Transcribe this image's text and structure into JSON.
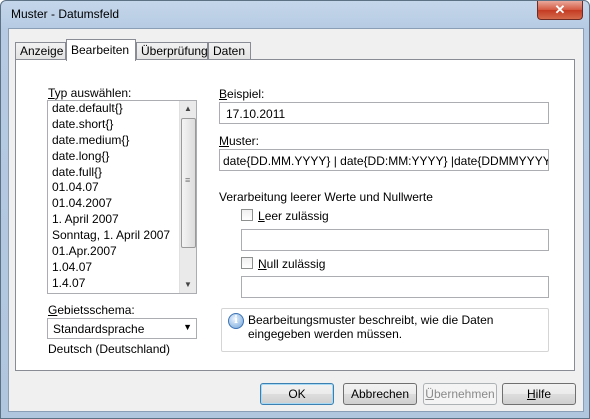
{
  "window": {
    "title": "Muster - Datumsfeld",
    "close_glyph": "✕"
  },
  "tabs": [
    {
      "label": "Anzeige",
      "active": false
    },
    {
      "label": "Bearbeiten",
      "active": true
    },
    {
      "label": "Überprüfung",
      "active": false
    },
    {
      "label": "Daten",
      "active": false
    }
  ],
  "left": {
    "type_label_first": "T",
    "type_label_rest": "yp auswählen:",
    "type_items": [
      "date.default{}",
      "date.short{}",
      "date.medium{}",
      "date.long{}",
      "date.full{}",
      "01.04.07",
      "01.04.2007",
      "1. April 2007",
      "Sonntag, 1. April 2007",
      "01.Apr.2007",
      "1.04.07",
      "1.4.07"
    ],
    "locale_label_first": "G",
    "locale_label_rest": "ebietsschema:",
    "locale_value": "Standardsprache",
    "locale_text": "Deutsch (Deutschland)"
  },
  "right": {
    "example_label_first": "B",
    "example_label_rest": "eispiel:",
    "example_value": "17.10.2011",
    "pattern_label_first": "M",
    "pattern_label_rest": "uster:",
    "pattern_value": "date{DD.MM.YYYY} | date{DD:MM:YYYY} |date{DDMMYYYY} |date{DD",
    "empty_section_label": "Verarbeitung leerer Werte und Nullwerte",
    "empty_check_first": "L",
    "empty_check_rest": "eer zulässig",
    "empty_value": "",
    "null_check_first": "N",
    "null_check_rest": "ull zulässig",
    "null_value": "",
    "info_text": "Bearbeitungsmuster beschreibt, wie die Daten eingegeben werden müssen."
  },
  "buttons": {
    "ok": "OK",
    "cancel": "Abbrechen",
    "apply_first": "Ü",
    "apply_rest": "bernehmen",
    "help_first": "H",
    "help_rest": "ilfe"
  }
}
